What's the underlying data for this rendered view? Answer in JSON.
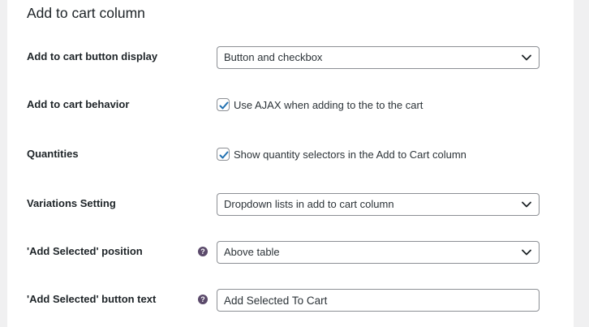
{
  "section": {
    "title": "Add to cart column"
  },
  "rows": {
    "button_display": {
      "label": "Add to cart button display",
      "value": "Button and checkbox"
    },
    "behavior": {
      "label": "Add to cart behavior",
      "checkbox_label": "Use AJAX when adding to the to the cart",
      "checked": true
    },
    "quantities": {
      "label": "Quantities",
      "checkbox_label": "Show quantity selectors in the Add to Cart column",
      "checked": true
    },
    "variations": {
      "label": "Variations Setting",
      "value": "Dropdown lists in add to cart column"
    },
    "add_selected_position": {
      "label": "'Add Selected' position",
      "help_icon": "?",
      "value": "Above table"
    },
    "add_selected_text": {
      "label": "'Add Selected' button text",
      "help_icon": "?",
      "value": "Add Selected To Cart"
    }
  },
  "colors": {
    "page_background": "#f0f0f1",
    "panel_background": "#ffffff",
    "text": "#1d2327",
    "input_border": "#8c8f94",
    "checkmark": "#2271b1",
    "help_icon": "#5b4a6b"
  },
  "icons": {
    "chevron": "chevron-down-icon",
    "check": "checkmark-icon",
    "help": "question-circle-icon"
  }
}
